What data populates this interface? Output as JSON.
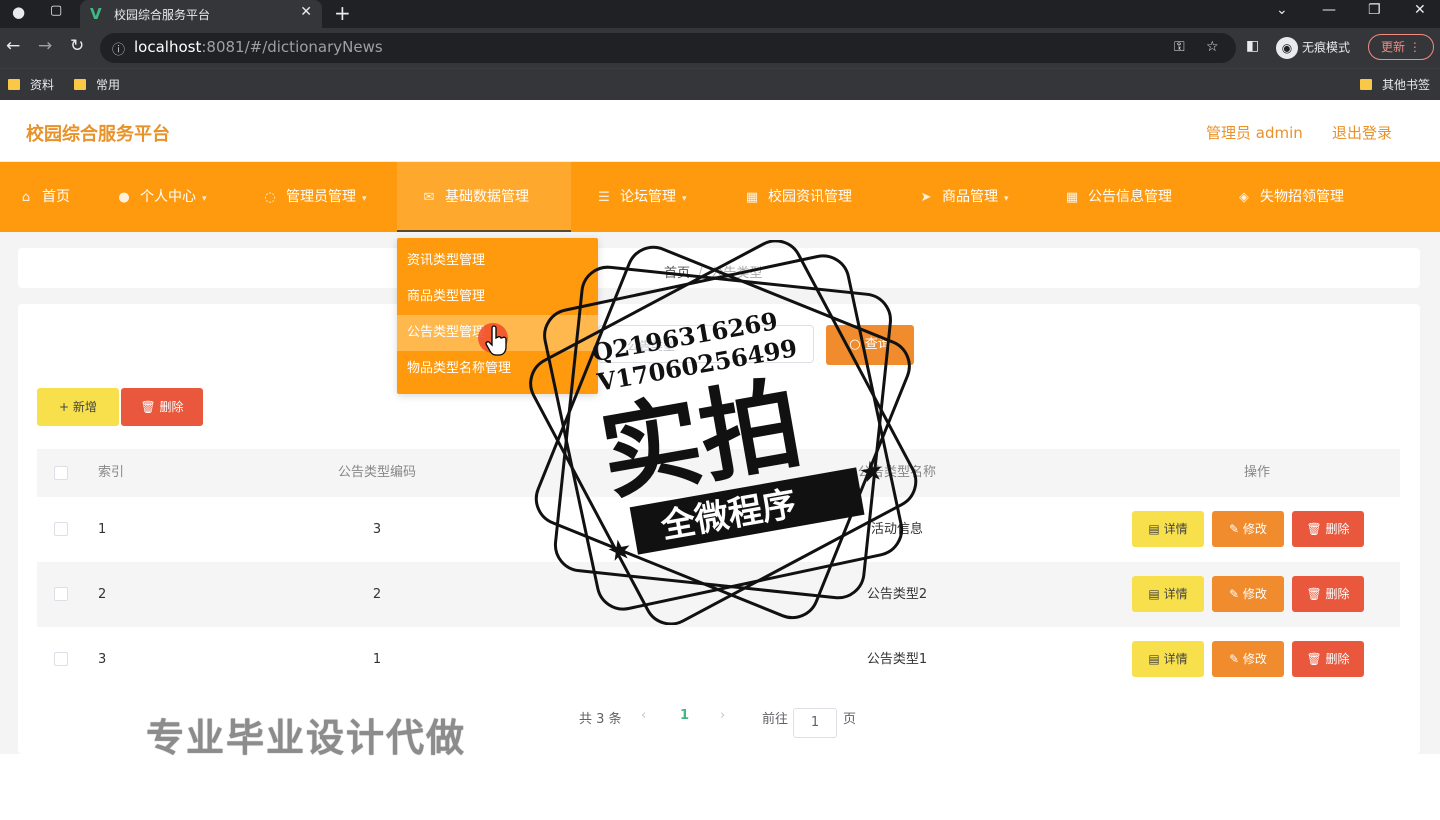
{
  "browser": {
    "tab_title": "校园综合服务平台",
    "url_host": "localhost",
    "url_path": ":8081/#/dictionaryNews",
    "incognito_label": "无痕模式",
    "update_label": "更新",
    "bookmarks": [
      "资料",
      "常用"
    ],
    "other_bookmarks": "其他书签"
  },
  "header": {
    "brand": "校园综合服务平台",
    "user": "管理员 admin",
    "logout": "退出登录"
  },
  "menu": {
    "items": [
      {
        "label": "首页",
        "icon": "home-icon"
      },
      {
        "label": "个人中心",
        "icon": "user-icon"
      },
      {
        "label": "管理员管理",
        "icon": "shield-icon"
      },
      {
        "label": "基础数据管理",
        "icon": "mail-icon"
      },
      {
        "label": "论坛管理",
        "icon": "list-icon"
      },
      {
        "label": "校园资讯管理",
        "icon": "grid-icon"
      },
      {
        "label": "商品管理",
        "icon": "send-icon"
      },
      {
        "label": "公告信息管理",
        "icon": "grid-icon"
      },
      {
        "label": "失物招领管理",
        "icon": "gift-icon"
      }
    ],
    "active_index": 3,
    "dropdown": [
      "资讯类型管理",
      "商品类型管理",
      "公告类型管理",
      "物品类型名称管理"
    ],
    "dropdown_hover_index": 2
  },
  "breadcrumb": {
    "home": "首页",
    "separator": "/",
    "current": "公告类型"
  },
  "search": {
    "placeholder": "公告类型",
    "button": "查询"
  },
  "actions": {
    "add": "新增",
    "delete": "删除"
  },
  "table": {
    "columns": [
      "索引",
      "公告类型编码",
      "公告类型名称",
      "操作"
    ],
    "rows": [
      {
        "index": "1",
        "code": "3",
        "name": "活动信息"
      },
      {
        "index": "2",
        "code": "2",
        "name": "公告类型2"
      },
      {
        "index": "3",
        "code": "1",
        "name": "公告类型1"
      }
    ],
    "op_detail": "详情",
    "op_edit": "修改",
    "op_delete": "删除"
  },
  "pagination": {
    "total": "共 3 条",
    "current": "1",
    "goto": "前往",
    "page_value": "1",
    "page_suffix": "页"
  },
  "watermark": {
    "contact_q": "Q2196316269",
    "contact_v": "V17060256499",
    "stamp_main": "实拍",
    "stamp_banner": "全微程序",
    "bottom_text": "专业毕业设计代做"
  },
  "colors": {
    "menu_bg": "#ff9a0e",
    "brand": "#e8922a",
    "add": "#f7e04b",
    "edit": "#f08c2e",
    "delete": "#e9583d"
  }
}
